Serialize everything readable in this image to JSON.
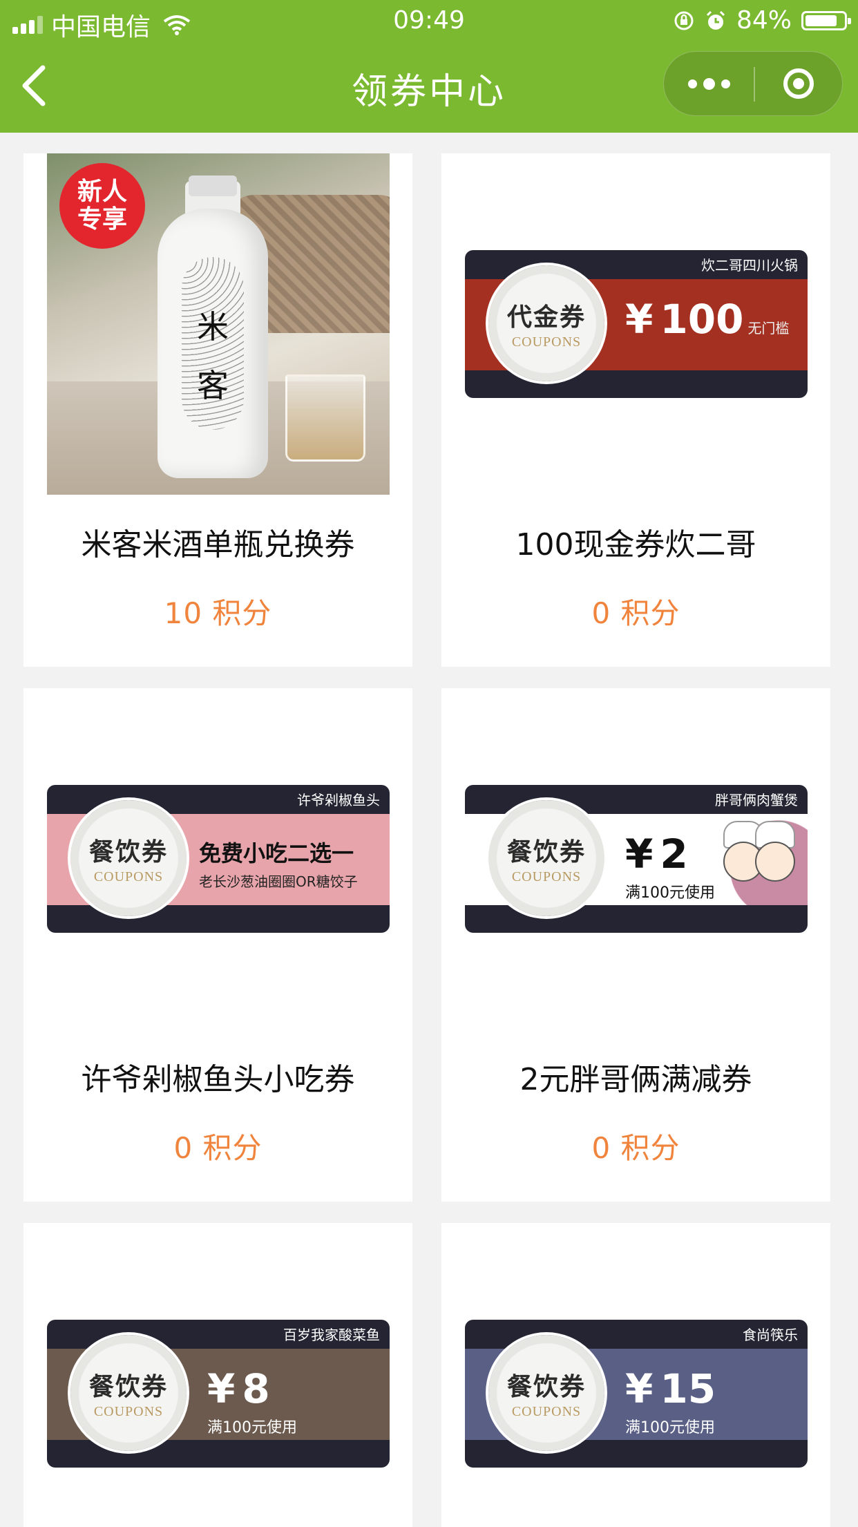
{
  "status_bar": {
    "carrier": "中国电信",
    "time": "09:49",
    "battery": "84%",
    "battery_level": 0.84
  },
  "header": {
    "title": "领券中心"
  },
  "cards": [
    {
      "name": "米客米酒单瓶兑换券",
      "points": "10 积分",
      "badge": [
        "新人",
        "专享"
      ],
      "label_top": "米",
      "label_bottom": "客"
    },
    {
      "name": "100现金券炊二哥",
      "points": "0 积分",
      "coupon": {
        "merchant": "炊二哥四川火锅",
        "kind": "代金券",
        "en": "COUPONS",
        "yen": "¥",
        "amount": "100",
        "cond": "无门槛",
        "band_color": "#a33020"
      }
    },
    {
      "name": "许爷剁椒鱼头小吃券",
      "points": "0 积分",
      "coupon": {
        "merchant": "许爷剁椒鱼头",
        "kind": "餐饮券",
        "en": "COUPONS",
        "main": "免费小吃二选一",
        "desc": "老长沙葱油圈圈OR糖饺子",
        "band_color": "#e7a5ab"
      }
    },
    {
      "name": "2元胖哥俩满减券",
      "points": "0 积分",
      "coupon": {
        "merchant": "胖哥俩肉蟹煲",
        "kind": "餐饮券",
        "en": "COUPONS",
        "yen": "¥",
        "amount": "2",
        "sub": "满100元使用",
        "band_color": "#ffffff"
      }
    },
    {
      "coupon": {
        "merchant": "百岁我家酸菜鱼",
        "kind": "餐饮券",
        "en": "COUPONS",
        "yen": "¥",
        "amount": "8",
        "sub": "满100元使用",
        "band_color": "#6b5a4d"
      }
    },
    {
      "coupon": {
        "merchant": "食尚筷乐",
        "kind": "餐饮券",
        "en": "COUPONS",
        "yen": "¥",
        "amount": "15",
        "sub": "满100元使用",
        "band_color": "#5a5f86"
      }
    }
  ]
}
